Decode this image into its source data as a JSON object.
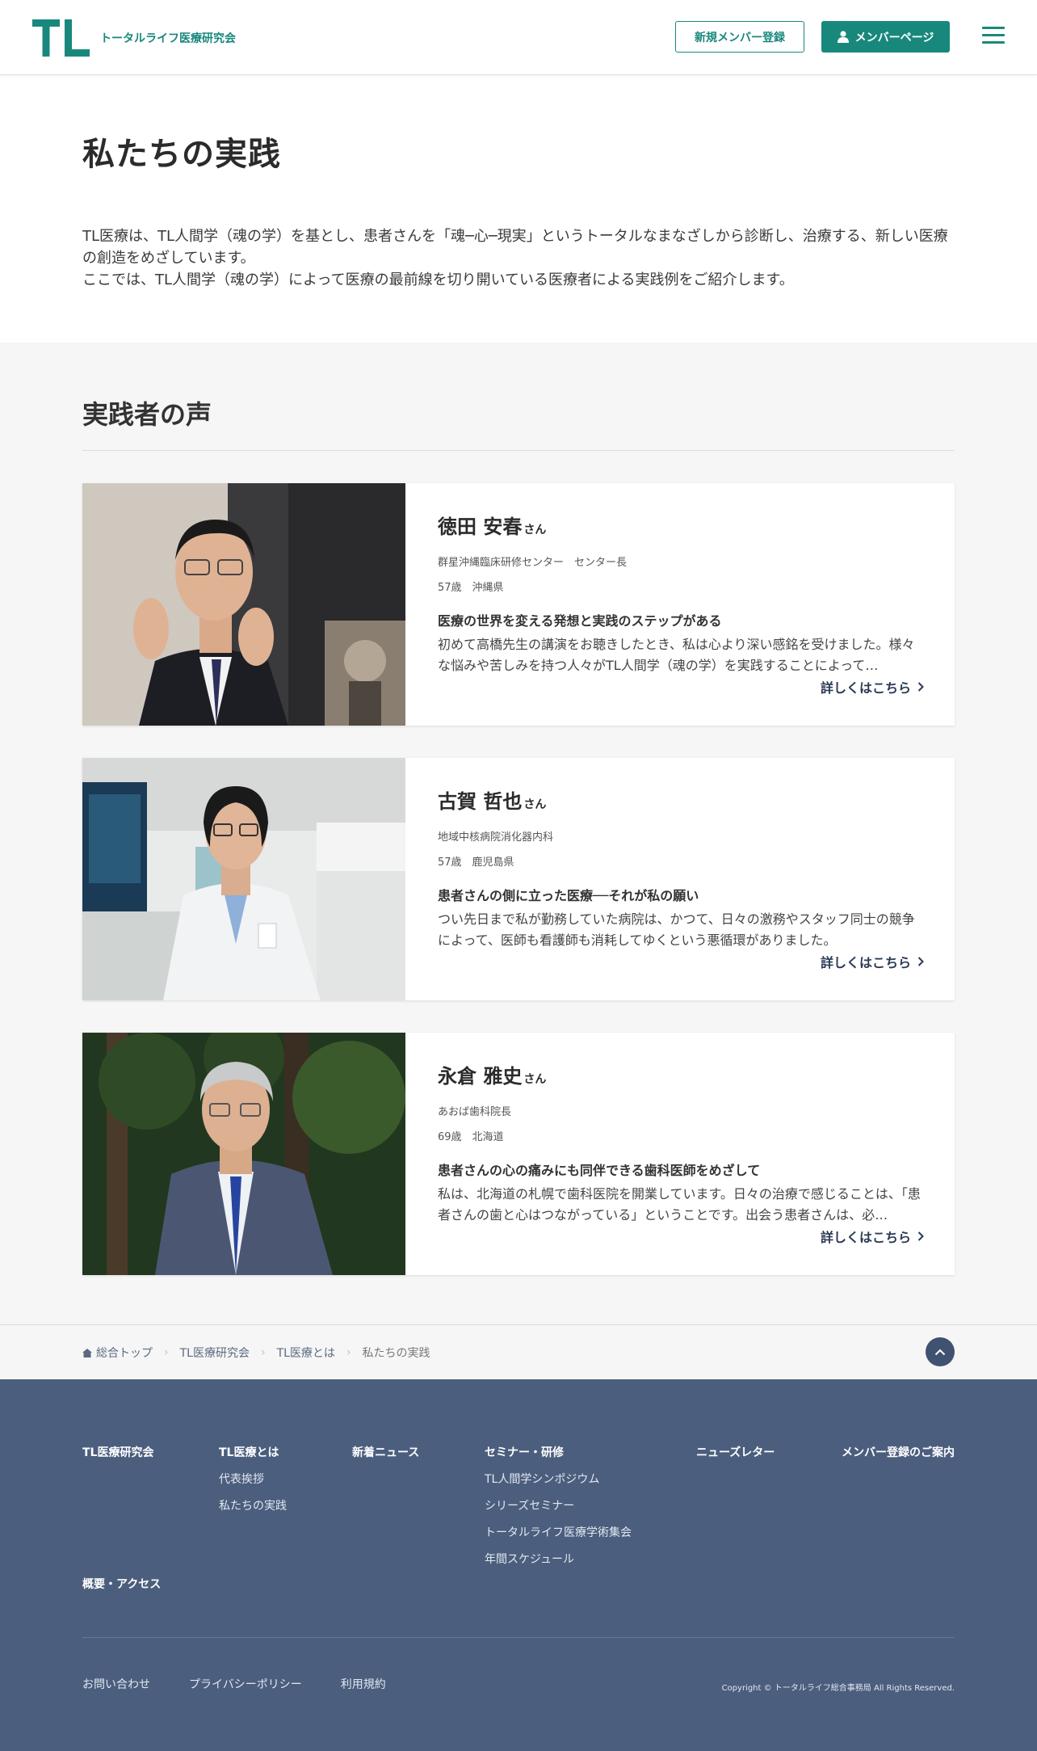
{
  "header": {
    "logo_mark": "TL",
    "logo_text": "トータルライフ医療研究会",
    "register_label": "新規メンバー登録",
    "member_label": "メンバーページ",
    "brand_color": "#19887c"
  },
  "intro": {
    "title": "私たちの実践",
    "paragraph1": "TL医療は、TL人間学（魂の学）を基とし、患者さんを「魂─心─現実」というトータルなまなざしから診断し、治療する、新しい医療の創造をめざしています。",
    "paragraph2": "ここでは、TL人間学（魂の学）によって医療の最前線を切り開いている医療者による実践例をご紹介します。"
  },
  "voices": {
    "title": "実践者の声",
    "more_label": "詳しくはこちら",
    "cards": [
      {
        "name": "徳田 安春",
        "honorific": "さん",
        "organization": "群星沖縄臨床研修センター　センター長",
        "age_region": "57歳　沖縄県",
        "heading": "医療の世界を変える発想と実践のステップがある",
        "excerpt": "初めて高橋先生の講演をお聴きしたとき、私は心より深い感銘を受けました。様々な悩みや苦しみを持つ人々がTL人間学（魂の学）を実践することによって…"
      },
      {
        "name": "古賀 哲也",
        "honorific": "さん",
        "organization": "地域中核病院消化器内科",
        "age_region": "57歳　鹿児島県",
        "heading": "患者さんの側に立った医療──それが私の願い",
        "excerpt": "つい先日まで私が勤務していた病院は、かつて、日々の激務やスタッフ同士の競争によって、医師も看護師も消耗してゆくという悪循環がありました。"
      },
      {
        "name": "永倉 雅史",
        "honorific": "さん",
        "organization": "あおば歯科院長",
        "age_region": "69歳　北海道",
        "heading": "患者さんの心の痛みにも同伴できる歯科医師をめざして",
        "excerpt": "私は、北海道の札幌で歯科医院を開業しています。日々の治療で感じることは、「患者さんの歯と心はつながっている」ということです。出会う患者さんは、必…"
      }
    ]
  },
  "breadcrumb": {
    "items": [
      "総合トップ",
      "TL医療研究会",
      "TL医療とは"
    ],
    "current": "私たちの実践"
  },
  "footer": {
    "columns": [
      {
        "heading": "TL医療研究会",
        "items": []
      },
      {
        "heading": "TL医療とは",
        "items": [
          "代表挨拶",
          "私たちの実践"
        ]
      },
      {
        "heading": "新着ニュース",
        "items": []
      },
      {
        "heading": "セミナー・研修",
        "items": [
          "TL人間学シンポジウム",
          "シリーズセミナー",
          "トータルライフ医療学術集会",
          "年間スケジュール"
        ]
      },
      {
        "heading": "ニューズレター",
        "items": []
      },
      {
        "heading": "メンバー登録のご案内",
        "items": []
      }
    ],
    "access": "概要・アクセス",
    "links": [
      "お問い合わせ",
      "プライバシーポリシー",
      "利用規約"
    ],
    "copyright": "Copyright © トータルライフ総合事務局 All Rights Reserved."
  }
}
